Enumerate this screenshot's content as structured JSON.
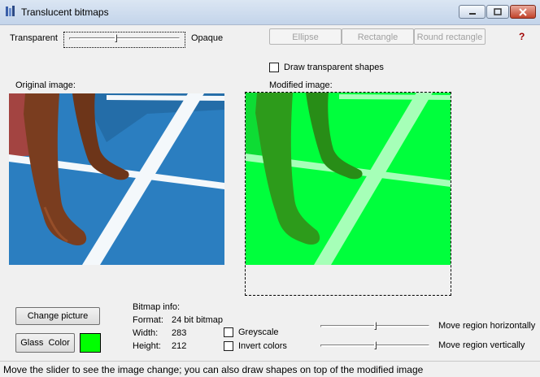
{
  "window": {
    "title": "Translucent bitmaps"
  },
  "transparency": {
    "left_label": "Transparent",
    "right_label": "Opaque",
    "level": 0.42
  },
  "shape_buttons": {
    "ellipse": "Ellipse",
    "rectangle": "Rectangle",
    "round_rectangle": "Round rectangle"
  },
  "help": {
    "label": "?"
  },
  "draw_shapes": {
    "label": "Draw transparent shapes",
    "checked": false
  },
  "original": {
    "label": "Original image:"
  },
  "modified": {
    "label": "Modified image:"
  },
  "actions": {
    "change_picture": "Change picture",
    "glass_color": "Glass  Color",
    "swatch_color": "#00ff00"
  },
  "bitmap_info": {
    "header": "Bitmap info:",
    "format_label": "Format:",
    "format_value": "24 bit bitmap",
    "width_label": "Width:",
    "width_value": "283",
    "height_label": "Height:",
    "height_value": "212"
  },
  "options": {
    "greyscale": "Greyscale",
    "invert": "Invert colors"
  },
  "move": {
    "horizontal_label": "Move region horizontally",
    "vertical_label": "Move region vertically",
    "horizontal_level": 0.5,
    "vertical_level": 0.5
  },
  "status": {
    "text": "Move the slider to see the image change; you can also draw shapes on top of the modified image"
  },
  "colors": {
    "glass_tint": "#00ff3c",
    "track_blue": "#2b7ec0",
    "skin": "#7a3d1f"
  }
}
